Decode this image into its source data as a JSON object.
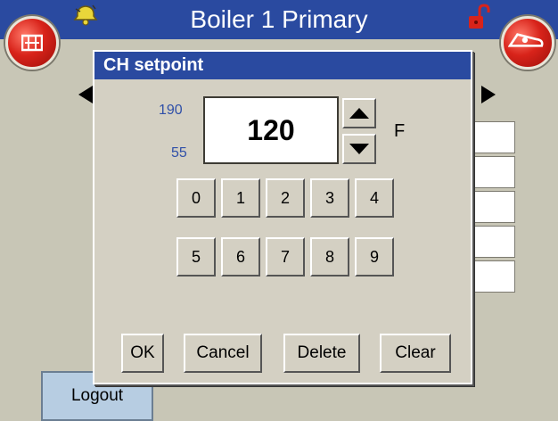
{
  "header": {
    "title": "Boiler 1 Primary"
  },
  "icons": {
    "left_button": "boiler-icon",
    "alarm": "bell-icon",
    "lock": "unlocked-padlock-icon",
    "right_button": "burner-icon"
  },
  "colors": {
    "titlebar": "#2a4aa0",
    "round_button": "#d8231a",
    "dialog_bg": "#d4d0c3",
    "limit_text": "#3050a8",
    "logout_bg": "#b7cde2"
  },
  "background": {
    "logout_label": "Logout"
  },
  "dialog": {
    "title": "CH setpoint",
    "max": "190",
    "min": "55",
    "value": "120",
    "unit": "F",
    "keypad": [
      "0",
      "1",
      "2",
      "3",
      "4",
      "5",
      "6",
      "7",
      "8",
      "9"
    ],
    "buttons": {
      "ok": "OK",
      "cancel": "Cancel",
      "delete": "Delete",
      "clear": "Clear"
    }
  }
}
